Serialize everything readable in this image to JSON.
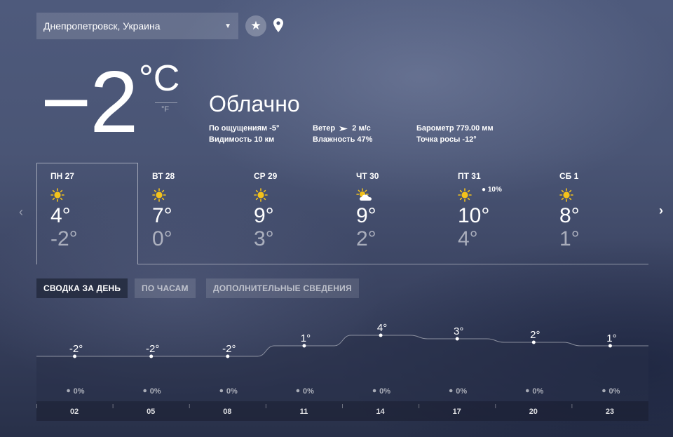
{
  "location": {
    "name": "Днепропетровск, Украина"
  },
  "current": {
    "temp": "−2",
    "unit_c": "°C",
    "unit_f": "°F",
    "condition": "Облачно",
    "details": {
      "feels_label": "По ощущениям",
      "feels_value": "-5°",
      "visibility_label": "Видимость",
      "visibility_value": "10 км",
      "wind_label": "Ветер",
      "wind_value": "2 м/с",
      "humidity_label": "Влажность",
      "humidity_value": "47%",
      "barometer_label": "Барометр",
      "barometer_value": "779.00 мм",
      "dew_label": "Точка росы",
      "dew_value": "-12°"
    }
  },
  "forecast": [
    {
      "day": "ПН 27",
      "hi": "4°",
      "lo": "-2°",
      "icon": "sun-icon",
      "precip": ""
    },
    {
      "day": "ВТ 28",
      "hi": "7°",
      "lo": "0°",
      "icon": "sun-icon",
      "precip": ""
    },
    {
      "day": "СР 29",
      "hi": "9°",
      "lo": "3°",
      "icon": "sun-icon",
      "precip": ""
    },
    {
      "day": "ЧТ 30",
      "hi": "9°",
      "lo": "2°",
      "icon": "partly-cloudy-icon",
      "precip": ""
    },
    {
      "day": "ПТ 31",
      "hi": "10°",
      "lo": "4°",
      "icon": "sun-icon",
      "precip": "10%"
    },
    {
      "day": "СБ 1",
      "hi": "8°",
      "lo": "1°",
      "icon": "sun-icon",
      "precip": ""
    }
  ],
  "tabs": {
    "summary": "СВОДКА ЗА ДЕНЬ",
    "hourly": "ПО ЧАСАМ",
    "details": "ДОПОЛНИТЕЛЬНЫЕ СВЕДЕНИЯ"
  },
  "colors": {
    "accent_sun": "#f3c21b",
    "selection_border": "#c9cede"
  },
  "chart_data": {
    "type": "area",
    "x": [
      "02",
      "05",
      "08",
      "11",
      "14",
      "17",
      "20",
      "23"
    ],
    "values": [
      -2,
      -2,
      -2,
      1,
      4,
      3,
      2,
      1
    ],
    "labels": [
      "-2°",
      "-2°",
      "-2°",
      "1°",
      "4°",
      "3°",
      "2°",
      "1°"
    ],
    "precip": [
      "0%",
      "0%",
      "0%",
      "0%",
      "0%",
      "0%",
      "0%",
      "0%"
    ],
    "grid": false
  }
}
